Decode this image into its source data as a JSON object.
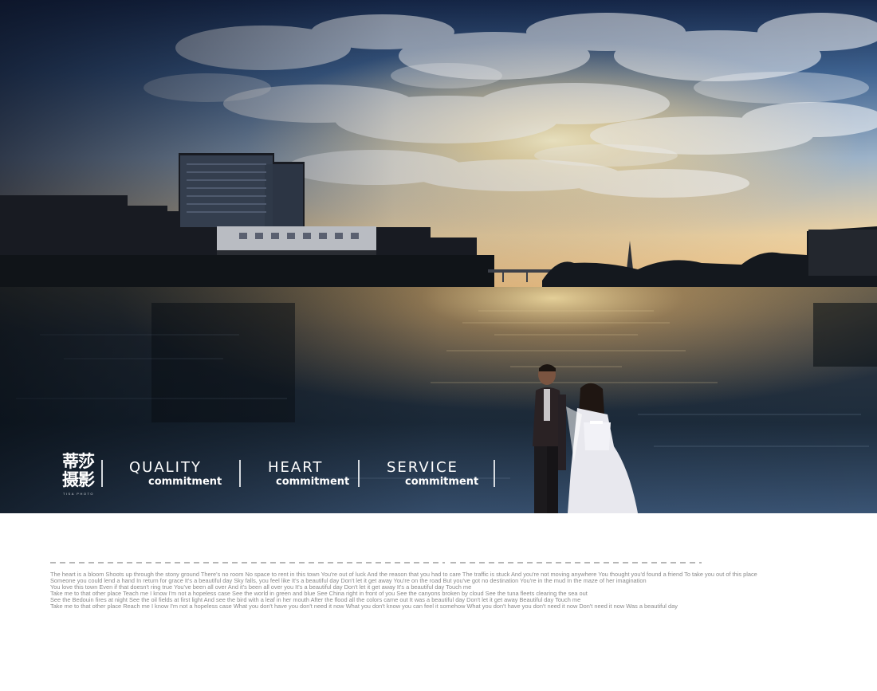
{
  "brand": {
    "name": "蒂莎摄影",
    "name_en": "TISA PHOTO"
  },
  "slogans": [
    {
      "title": "QUALITY",
      "subtitle": "commitment"
    },
    {
      "title": "HEART",
      "subtitle": "commitment"
    },
    {
      "title": "SERVICE",
      "subtitle": "commitment"
    }
  ],
  "lyrics": [
    "The heart is a bloom Shoots up through the stony ground There's no room No space to rent in this town You're out of luck And the reason that you had to care The traffic is stuck And you're not moving anywhere  You thought you'd found a friend To take you out of this place",
    "Someone you could lend a hand In return for grace It's a beautiful day  Sky falls, you feel like It's a beautiful day Don't let it get away  You're on the road But you've got no destination  You're in the mud In the maze of her imagination",
    "You love this town Even if that doesn't ring true  You've been all over And it's been all over you It's a beautiful day  Don't let it get away It's a beautiful day Touch me",
    "Take me to that other place Teach me I know I'm not a hopeless case  See the world in green and blue See  China right in front of you  See the canyons broken by cloud See the tuna fleets clearing the sea out",
    "See the Bedouin fires at night See the oil fields at first light And see the bird with a leaf in her mouth After the  flood all the colors came out It was a beautiful day Don't let it get away Beautiful day Touch me",
    "Take me to that other place  Reach me I know I'm not a hopeless case  What you don't have you don't need it now What you don't know you can feel it somehow  What you don't have you don't need it now Don't need it now Was a beautiful day"
  ],
  "colors": {
    "sky_top": "#1c2f4f",
    "sky_mid": "#6f90b8",
    "horizon": "#f5d79a",
    "sun": "#fff4c6",
    "water_dark": "#0f1822",
    "dashes": "#6d6d6d",
    "lyrics_text": "#8a8a8a"
  }
}
